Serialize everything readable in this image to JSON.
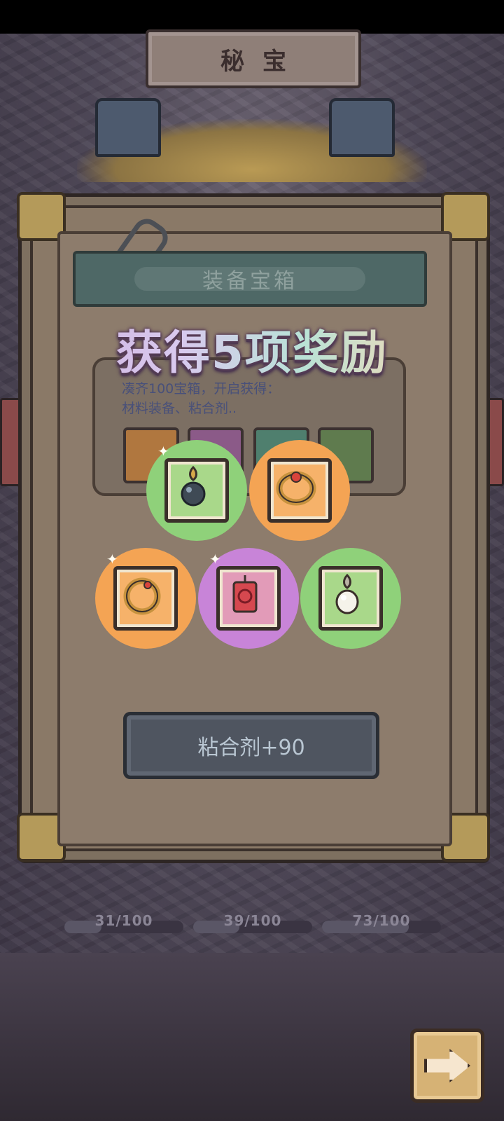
{
  "header": {
    "title": "秘宝"
  },
  "board": {
    "title": "装备宝箱",
    "info_line1": "凑齐100宝箱，开启获得：",
    "info_line2": "材料装备、粘合剂.."
  },
  "banner": {
    "text": "获得5项奖励"
  },
  "rewards": [
    {
      "name": "black-pearl-pendant",
      "rarity_color": "#8fd17a"
    },
    {
      "name": "orange-ruby-ring",
      "rarity_color": "#f4a454"
    },
    {
      "name": "gold-ring",
      "rarity_color": "#f4a454"
    },
    {
      "name": "rune-tag-amulet",
      "rarity_color": "#c884d8"
    },
    {
      "name": "white-pearl-pendant",
      "rarity_color": "#8fd17a"
    }
  ],
  "reward_button": {
    "label": "粘合剂+90"
  },
  "progress": [
    {
      "label": "31/100",
      "value": 31,
      "max": 100
    },
    {
      "label": "39/100",
      "value": 39,
      "max": 100
    },
    {
      "label": "73/100",
      "value": 73,
      "max": 100
    }
  ],
  "icons": {
    "next": "arrow-right-icon"
  }
}
